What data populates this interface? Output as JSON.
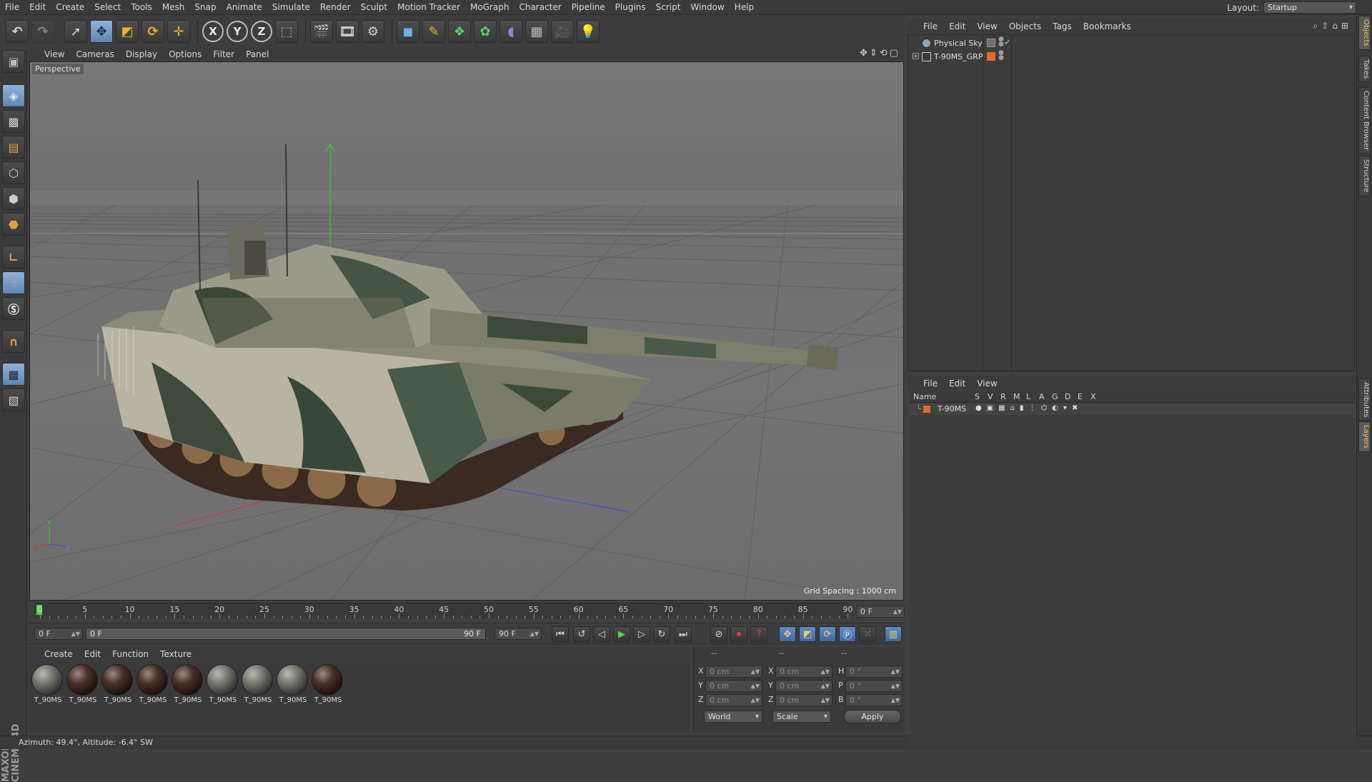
{
  "menubar": {
    "items": [
      "File",
      "Edit",
      "Create",
      "Select",
      "Tools",
      "Mesh",
      "Snap",
      "Animate",
      "Simulate",
      "Render",
      "Sculpt",
      "Motion Tracker",
      "MoGraph",
      "Character",
      "Pipeline",
      "Plugins",
      "Script",
      "Window",
      "Help"
    ],
    "layout_label": "Layout:",
    "layout_value": "Startup"
  },
  "toolbar": {
    "axis_x": "X",
    "axis_y": "Y",
    "axis_z": "Z"
  },
  "viewport": {
    "menu": [
      "View",
      "Cameras",
      "Display",
      "Options",
      "Filter",
      "Panel"
    ],
    "label": "Perspective",
    "grid_spacing": "Grid Spacing : 1000 cm",
    "axis_x": "X",
    "axis_y": "Y",
    "axis_z": "Z"
  },
  "timeline": {
    "ticks": [
      "0",
      "5",
      "10",
      "15",
      "20",
      "25",
      "30",
      "35",
      "40",
      "45",
      "50",
      "55",
      "60",
      "65",
      "70",
      "75",
      "80",
      "85",
      "90"
    ],
    "frame_end_display": "0 F",
    "current_frame": "0 F",
    "range_start": "0 F",
    "range_end": "90 F",
    "max_frame": "90 F"
  },
  "materials": {
    "menu": [
      "Create",
      "Edit",
      "Function",
      "Texture"
    ],
    "items": [
      {
        "label": "T_90MS",
        "style": "grey"
      },
      {
        "label": "T_90MS",
        "style": "brown"
      },
      {
        "label": "T_90MS",
        "style": "brown"
      },
      {
        "label": "T_90MS",
        "style": "brown"
      },
      {
        "label": "T_90MS",
        "style": "brown"
      },
      {
        "label": "T_90MS",
        "style": "grey"
      },
      {
        "label": "T_90MS",
        "style": "grey"
      },
      {
        "label": "T_90MS",
        "style": "grey"
      },
      {
        "label": "T_90MS",
        "style": "brown"
      }
    ]
  },
  "coordinates": {
    "headers": [
      "--",
      "--",
      "--"
    ],
    "rows": [
      {
        "a": "X",
        "av": "0 cm",
        "b": "X",
        "bv": "0 cm",
        "c": "H",
        "cv": "0 °"
      },
      {
        "a": "Y",
        "av": "0 cm",
        "b": "Y",
        "bv": "0 cm",
        "c": "P",
        "cv": "0 °"
      },
      {
        "a": "Z",
        "av": "0 cm",
        "b": "Z",
        "bv": "0 cm",
        "c": "B",
        "cv": "0 °"
      }
    ],
    "space": "World",
    "mode": "Scale",
    "apply": "Apply"
  },
  "status": {
    "text": "Azimuth: 49.4°, Altitude: -6.4°  SW"
  },
  "objects": {
    "menu": [
      "File",
      "Edit",
      "View",
      "Objects",
      "Tags",
      "Bookmarks"
    ],
    "items": [
      {
        "name": "Physical Sky",
        "kind": "sky"
      },
      {
        "name": "T-90MS_GRP",
        "kind": "null"
      }
    ]
  },
  "layers": {
    "menu": [
      "File",
      "Edit",
      "View"
    ],
    "columns": [
      "Name",
      "S",
      "V",
      "R",
      "M",
      "L",
      "A",
      "G",
      "D",
      "E",
      "X"
    ],
    "rows": [
      {
        "name": "T-90MS"
      }
    ]
  },
  "vtabs": [
    "Objects",
    "Takes",
    "Content Browser",
    "Structure",
    "Attributes",
    "Layers"
  ],
  "brand": {
    "logo": "MAXON CINEMA 4D"
  },
  "colors": {
    "accent_blue": "#5f85b3",
    "play_green": "#4ddc4d",
    "layer_orange": "#e06a2a"
  }
}
